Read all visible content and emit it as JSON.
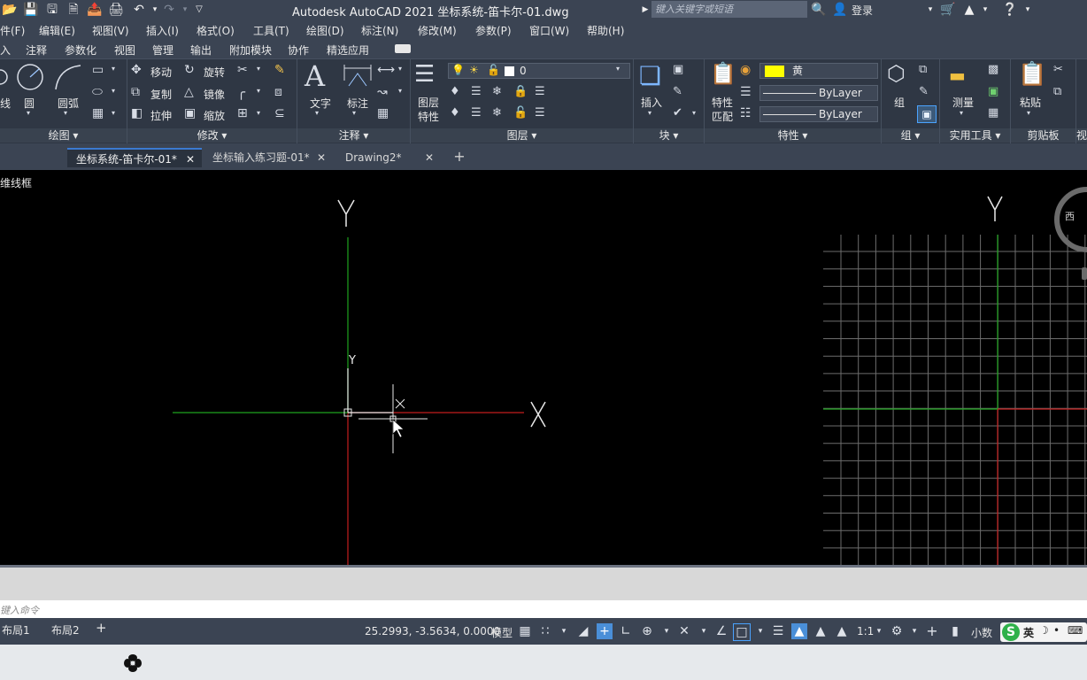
{
  "title": "Autodesk AutoCAD 2021    坐标系统-笛卡尔-01.dwg",
  "search_placeholder": "键入关键字或短语",
  "login": "登录",
  "menu": [
    "件(F)",
    "编辑(E)",
    "视图(V)",
    "插入(I)",
    "格式(O)",
    "工具(T)",
    "绘图(D)",
    "标注(N)",
    "修改(M)",
    "参数(P)",
    "窗口(W)",
    "帮助(H)"
  ],
  "ribbon_tabs": [
    "入",
    "注释",
    "参数化",
    "视图",
    "管理",
    "输出",
    "附加模块",
    "协作",
    "精选应用"
  ],
  "panels": {
    "draw": {
      "title": "绘图",
      "line": "线",
      "circle": "圆",
      "arc": "圆弧"
    },
    "modify": {
      "title": "修改",
      "move": "移动",
      "rotate": "旋转",
      "copy": "复制",
      "mirror": "镜像",
      "stretch": "拉伸",
      "scale": "缩放"
    },
    "annotation": {
      "title": "注释",
      "text": "文字",
      "dimension": "标注"
    },
    "layers": {
      "title": "图层",
      "props_line1": "图层",
      "props_line2": "特性",
      "current_layer": "0"
    },
    "block": {
      "title": "块",
      "insert": "插入"
    },
    "properties": {
      "title": "特性",
      "match_line1": "特性",
      "match_line2": "匹配",
      "color": "黄",
      "linetype": "ByLayer",
      "lineweight": "ByLayer",
      "color_hex": "#ffff00"
    },
    "group": {
      "title": "组",
      "group": "组"
    },
    "utilities": {
      "title": "实用工具",
      "measure": "测量"
    },
    "clipboard": {
      "title": "剪贴板",
      "paste": "粘贴"
    },
    "view_partial": "视"
  },
  "doc_tabs": [
    "坐标系统-笛卡尔-01*",
    "坐标输入练习题-01*",
    "Drawing2*"
  ],
  "viewport_label": "维线框",
  "axes": {
    "y_left": "Y",
    "x_left": "X",
    "ucs_y": "Y",
    "y_right": "Y",
    "compass": "西"
  },
  "command_placeholder": "键入命令",
  "layout_tabs": [
    "布局1",
    "布局2"
  ],
  "status": {
    "coords": "25.2993, -3.5634, 0.0000",
    "model": "模型",
    "scale": "1:1",
    "units": "小数",
    "ime": "英"
  },
  "colors": {
    "x_axis": "#c41e1e",
    "y_axis": "#1fa31f",
    "grid": "#6d6d6d",
    "ui_bg": "#3b4453",
    "ribbon_bg": "#2f3744"
  }
}
